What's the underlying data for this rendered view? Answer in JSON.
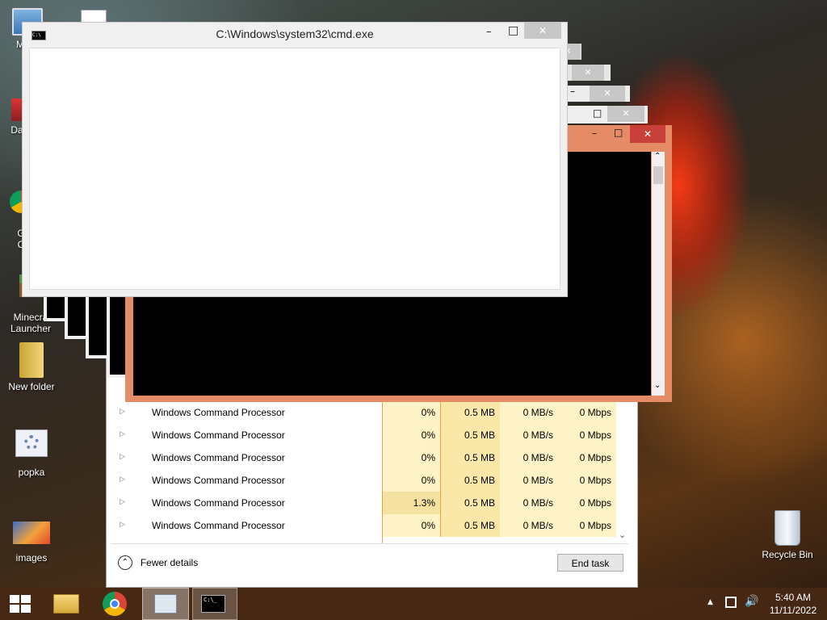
{
  "desktop": {
    "icons": [
      {
        "label": "My C",
        "icon": "computer-icon"
      },
      {
        "label": "Data",
        "icon": "shortcut-icon"
      },
      {
        "label": "G\nC",
        "icon": "chrome-icon"
      },
      {
        "label": "Minecra\nLauncher",
        "icon": "minecraft-icon"
      },
      {
        "label": "New folder",
        "icon": "folder-icon"
      },
      {
        "label": "popka",
        "icon": "settings-file-icon"
      },
      {
        "label": "images",
        "icon": "image-icon"
      },
      {
        "label": "Recycle Bin",
        "icon": "recycle-bin-icon"
      }
    ]
  },
  "cmd_window": {
    "title": "C:\\Windows\\system32\\cmd.exe",
    "minimize": "–",
    "maximize": "□",
    "close": "✕"
  },
  "task_manager": {
    "rows": [
      {
        "name": "Windows Command Processor",
        "cpu": "0%",
        "memory": "0.5 MB",
        "disk": "0 MB/s",
        "network": "0 Mbps"
      },
      {
        "name": "Windows Command Processor",
        "cpu": "0%",
        "memory": "0.5 MB",
        "disk": "0 MB/s",
        "network": "0 Mbps"
      },
      {
        "name": "Windows Command Processor",
        "cpu": "0%",
        "memory": "0.5 MB",
        "disk": "0 MB/s",
        "network": "0 Mbps"
      },
      {
        "name": "Windows Command Processor",
        "cpu": "0%",
        "memory": "0.5 MB",
        "disk": "0 MB/s",
        "network": "0 Mbps"
      },
      {
        "name": "Windows Command Processor",
        "cpu": "1.3%",
        "memory": "0.5 MB",
        "disk": "0 MB/s",
        "network": "0 Mbps"
      },
      {
        "name": "Windows Command Processor",
        "cpu": "0%",
        "memory": "0.5 MB",
        "disk": "0 MB/s",
        "network": "0 Mbps"
      }
    ],
    "fewer_details": "Fewer details",
    "end_task": "End task"
  },
  "taskbar": {
    "time": "5:40 AM",
    "date": "11/11/2022",
    "pinned": [
      "start-icon",
      "file-explorer-icon",
      "chrome-icon",
      "task-manager-icon",
      "cmd-icon"
    ]
  }
}
